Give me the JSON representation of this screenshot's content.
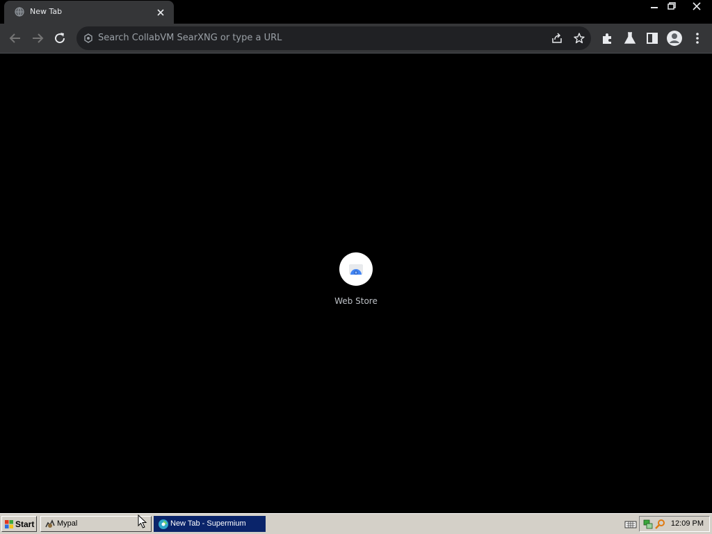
{
  "browser": {
    "tab": {
      "title": "New Tab",
      "favicon": "globe-icon",
      "close": "close-icon"
    },
    "window_controls": [
      "minimize-icon",
      "restore-icon",
      "close-icon"
    ],
    "toolbar": {
      "omnibox_placeholder": "Search CollabVM SearXNG or type a URL",
      "icons": [
        "back-arrow-icon",
        "forward-arrow-icon",
        "reload-icon",
        "share-icon",
        "star-icon",
        "extensions-puzzle-icon",
        "labs-flask-icon",
        "side-panel-icon",
        "profile-avatar-icon",
        "menu-kebab-icon"
      ]
    }
  },
  "content": {
    "shortcuts": [
      {
        "label": "Web Store",
        "icon": "web-store-icon"
      }
    ]
  },
  "taskbar": {
    "start_label": "Start",
    "tasks": [
      {
        "label": "Mypal",
        "icon": "mypal-icon",
        "active": false
      },
      {
        "label": "New Tab - Supermium",
        "icon": "supermium-icon",
        "active": true
      }
    ],
    "tray": {
      "clock": "12:09 PM",
      "icons": [
        "keyboard-icon",
        "network-icon",
        "search-key-icon"
      ]
    }
  },
  "colors": {
    "chrome_bg": "#353638",
    "omnibox_bg": "#202124",
    "content_bg": "#000000",
    "taskbar_bg": "#d4d0c8",
    "active_task": "#0a246a"
  }
}
